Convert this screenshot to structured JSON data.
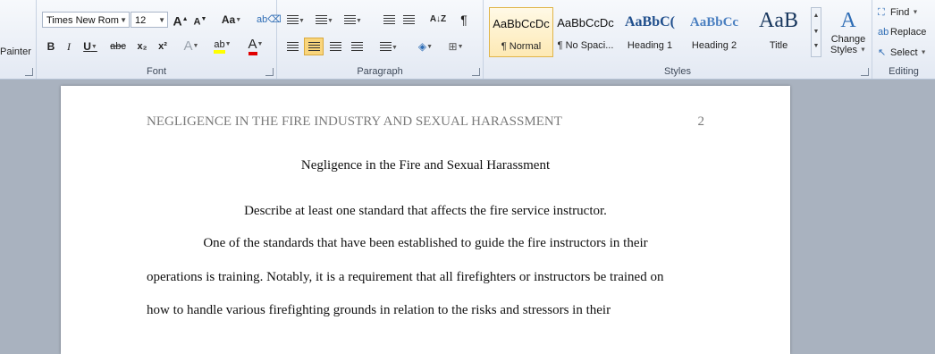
{
  "clipboard": {
    "painter_label": "Painter"
  },
  "font": {
    "name": "Times New Rom",
    "size": "12",
    "grow": "A",
    "shrink": "A",
    "case": "Aa",
    "bold": "B",
    "italic": "I",
    "underline": "U",
    "strike": "abc",
    "subscript": "x₂",
    "superscript": "x²",
    "effects": "A",
    "highlight": "ab",
    "color": "A",
    "group_label": "Font"
  },
  "paragraph": {
    "group_label": "Paragraph",
    "sort": "A↓Z",
    "pilcrow": "¶"
  },
  "styles": {
    "items": [
      {
        "sample": "AaBbCcDc",
        "name": "¶ Normal"
      },
      {
        "sample": "AaBbCcDc",
        "name": "¶ No Spaci..."
      },
      {
        "sample": "AaBbC(",
        "name": "Heading 1"
      },
      {
        "sample": "AaBbCc",
        "name": "Heading 2"
      },
      {
        "sample": "AaB",
        "name": "Title"
      }
    ],
    "change_line1": "Change",
    "change_line2": "Styles",
    "group_label": "Styles"
  },
  "editing": {
    "find": "Find",
    "replace": "Replace",
    "select": "Select",
    "group_label": "Editing"
  },
  "document": {
    "running_head": "NEGLIGENCE IN THE FIRE INDUSTRY AND SEXUAL HARASSMENT",
    "page_number": "2",
    "title": "Negligence in the Fire and Sexual Harassment",
    "lines": [
      "Describe at least one standard that affects the fire service instructor.",
      "One of the standards that have been established to guide the fire instructors in their",
      "operations is training. Notably, it is a requirement that all firefighters or instructors be trained on",
      "how to handle various firefighting grounds in relation to the risks and stressors in their"
    ]
  },
  "colors": {
    "highlight": "#ffff00",
    "font_color": "#e00000",
    "ribbon_accent": "#2f6db5"
  }
}
